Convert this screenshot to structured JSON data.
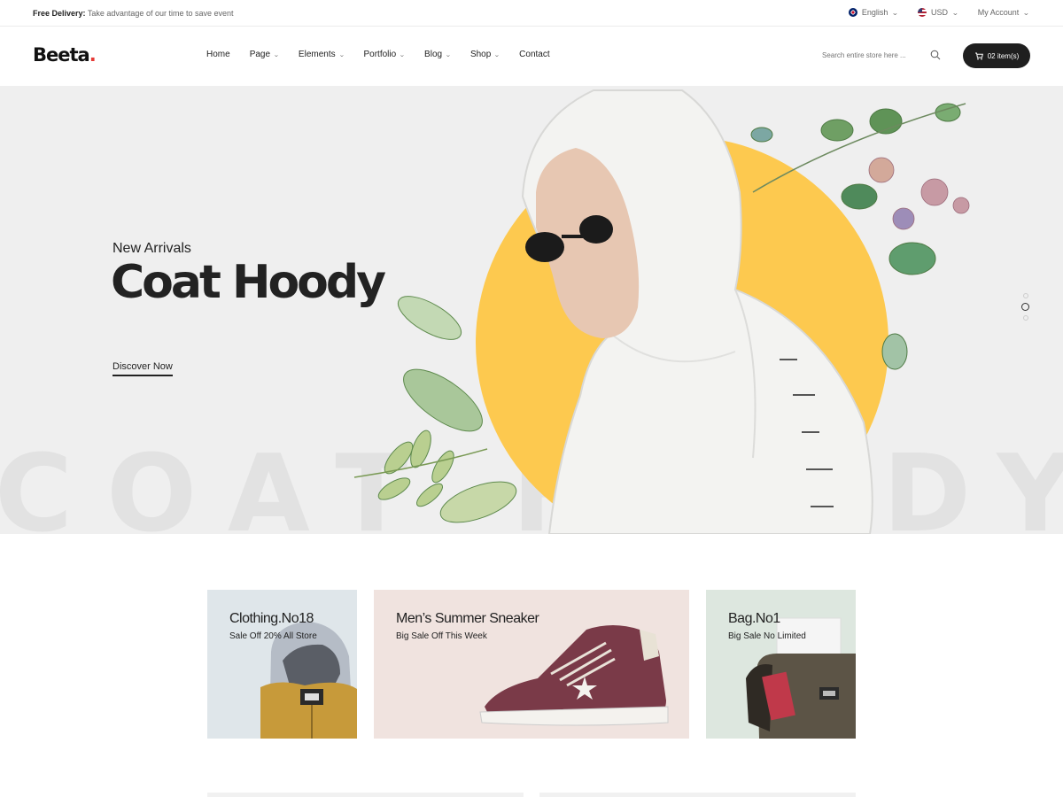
{
  "topbar": {
    "promo_label": "Free Delivery:",
    "promo_text": "Take advantage of our time to save event",
    "language": "English",
    "currency": "USD",
    "account": "My Account"
  },
  "header": {
    "logo": "Beeta",
    "logo_dot": ".",
    "nav": [
      {
        "label": "Home"
      },
      {
        "label": "Page"
      },
      {
        "label": "Elements"
      },
      {
        "label": "Portfolio"
      },
      {
        "label": "Blog"
      },
      {
        "label": "Shop"
      },
      {
        "label": "Contact"
      }
    ],
    "search_placeholder": "Search entire store here ...",
    "cart_label": "02 item(s)"
  },
  "hero": {
    "subtitle": "New Arrivals",
    "title": "Coat Hoody",
    "cta": "Discover Now",
    "background_text": "COAT HOODY",
    "slides": 3,
    "active_slide": 2,
    "accent_color": "#fdc94f"
  },
  "banners": [
    {
      "title": "Clothing.No18",
      "subtitle": "Sale Off 20% All Store"
    },
    {
      "title": "Men’s Summer Sneaker",
      "subtitle": "Big Sale Off This Week"
    },
    {
      "title": "Bag.No1",
      "subtitle": "Big Sale No Limited"
    }
  ]
}
